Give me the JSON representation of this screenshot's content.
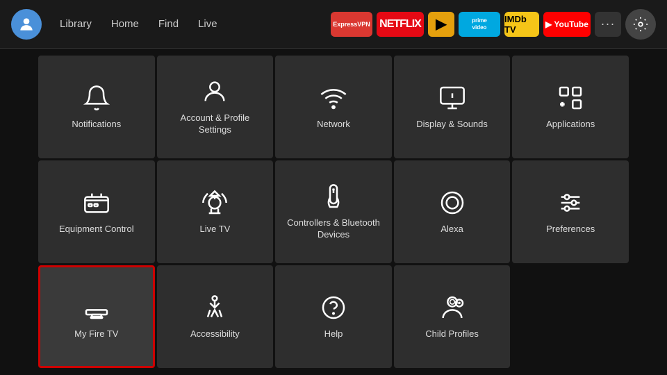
{
  "nav": {
    "links": [
      "Library",
      "Home",
      "Find",
      "Live"
    ],
    "apps": [
      {
        "name": "ExpressVPN",
        "label": "Express\nVPN",
        "class": "app-expressvpn"
      },
      {
        "name": "Netflix",
        "label": "NETFLIX",
        "class": "app-netflix"
      },
      {
        "name": "Plex",
        "label": "▶",
        "class": "app-plex"
      },
      {
        "name": "Prime Video",
        "label": "prime\nvideo",
        "class": "app-prime"
      },
      {
        "name": "IMDb TV",
        "label": "IMDb TV",
        "class": "app-imdb"
      },
      {
        "name": "YouTube",
        "label": "▶ YouTube",
        "class": "app-youtube"
      }
    ],
    "more_label": "···",
    "settings_label": "⚙"
  },
  "grid": {
    "items": [
      {
        "id": "notifications",
        "label": "Notifications",
        "icon": "bell"
      },
      {
        "id": "account-profile",
        "label": "Account & Profile Settings",
        "icon": "person"
      },
      {
        "id": "network",
        "label": "Network",
        "icon": "wifi"
      },
      {
        "id": "display-sounds",
        "label": "Display & Sounds",
        "icon": "display"
      },
      {
        "id": "applications",
        "label": "Applications",
        "icon": "apps"
      },
      {
        "id": "equipment-control",
        "label": "Equipment Control",
        "icon": "tv"
      },
      {
        "id": "live-tv",
        "label": "Live TV",
        "icon": "antenna"
      },
      {
        "id": "controllers-bluetooth",
        "label": "Controllers & Bluetooth Devices",
        "icon": "remote"
      },
      {
        "id": "alexa",
        "label": "Alexa",
        "icon": "alexa"
      },
      {
        "id": "preferences",
        "label": "Preferences",
        "icon": "sliders"
      },
      {
        "id": "my-fire-tv",
        "label": "My Fire TV",
        "icon": "firetv",
        "selected": true
      },
      {
        "id": "accessibility",
        "label": "Accessibility",
        "icon": "accessibility"
      },
      {
        "id": "help",
        "label": "Help",
        "icon": "help"
      },
      {
        "id": "child-profiles",
        "label": "Child Profiles",
        "icon": "child"
      },
      {
        "id": "empty",
        "label": "",
        "icon": "none"
      }
    ]
  }
}
